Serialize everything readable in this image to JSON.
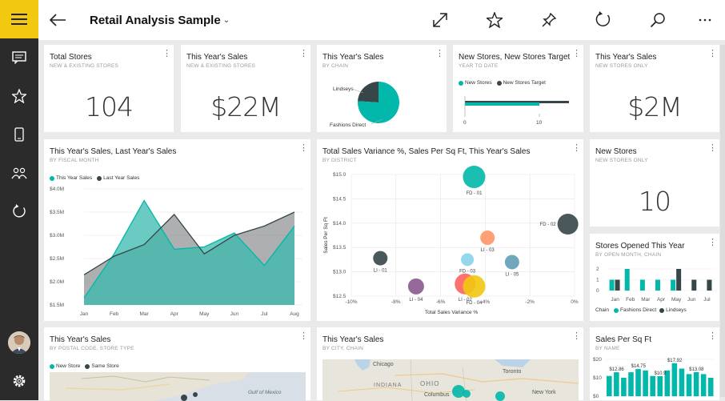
{
  "report_title": "Retail Analysis Sample",
  "colors": {
    "accent": "#f2c811",
    "teal": "#01b8aa",
    "dark": "#374649",
    "coral": "#fd625e",
    "yellow": "#f2c80f",
    "orange": "#fe9666",
    "blue": "#5f9eb5",
    "purple": "#8a5a8f"
  },
  "rail_icons": [
    "menu-icon",
    "chat-icon",
    "star-icon",
    "phone-icon",
    "people-icon",
    "refresh-icon",
    "avatar",
    "gear-icon"
  ],
  "tiles": {
    "total_stores": {
      "title": "Total Stores",
      "subtitle": "NEW & EXISTING STORES",
      "value": "104"
    },
    "sales_new_existing": {
      "title": "This Year's Sales",
      "subtitle": "NEW & EXISTING STORES",
      "value": "$22M"
    },
    "sales_by_chain": {
      "title": "This Year's Sales",
      "subtitle": "BY CHAIN",
      "labels": [
        "Lindseys",
        "Fashions Direct"
      ]
    },
    "new_stores_target": {
      "title": "New Stores, New Stores Target",
      "subtitle": "YEAR TO DATE",
      "legend": [
        "New Stores",
        "New Stores Target"
      ],
      "ticks": [
        "0",
        "10"
      ]
    },
    "sales_new_only": {
      "title": "This Year's Sales",
      "subtitle": "NEW STORES ONLY",
      "value": "$2M"
    },
    "sales_vs_last": {
      "title": "This Year's Sales, Last Year's Sales",
      "subtitle": "BY FISCAL MONTH",
      "legend": [
        "This Year Sales",
        "Last Year Sales"
      ]
    },
    "variance": {
      "title": "Total Sales Variance %, Sales Per Sq Ft, This Year's Sales",
      "subtitle": "BY DISTRICT",
      "xlabel": "Total Sales Variance %",
      "ylabel": "Sales Per Sq Ft"
    },
    "new_stores": {
      "title": "New Stores",
      "subtitle": "NEW STORES ONLY",
      "value": "10"
    },
    "stores_opened": {
      "title": "Stores Opened This Year",
      "subtitle": "BY OPEN MONTH, CHAIN",
      "legend_title": "Chain",
      "legend": [
        "Fashions Direct",
        "Lindseys"
      ]
    },
    "sales_postal": {
      "title": "This Year's Sales",
      "subtitle": "BY POSTAL CODE, STORE TYPE",
      "legend": [
        "New Store",
        "Same Store"
      ],
      "map_labels": [
        "Gulf of Mexico"
      ]
    },
    "sales_city": {
      "title": "This Year's Sales",
      "subtitle": "BY CITY, CHAIN",
      "map_labels": [
        "Chicago",
        "INDIANA",
        "OHIO",
        "Columbus",
        "Toronto",
        "New York"
      ]
    },
    "sales_sqft": {
      "title": "Sales Per Sq Ft",
      "subtitle": "BY NAME"
    }
  },
  "chart_data": [
    {
      "type": "area",
      "title": "This Year's Sales, Last Year's Sales",
      "categories": [
        "Jan",
        "Feb",
        "Mar",
        "Apr",
        "May",
        "Jun",
        "Jul",
        "Aug"
      ],
      "y_ticks": [
        "$4.0M",
        "$3.5M",
        "$3.0M",
        "$2.5M",
        "$2.0M",
        "$1.5M"
      ],
      "ylim": [
        1.5,
        4.0
      ],
      "series": [
        {
          "name": "This Year Sales",
          "values": [
            1.65,
            2.6,
            3.75,
            2.7,
            2.75,
            3.05,
            2.35,
            3.2
          ]
        },
        {
          "name": "Last Year Sales",
          "values": [
            2.15,
            2.55,
            2.8,
            3.45,
            2.6,
            3.0,
            3.2,
            3.5
          ]
        }
      ]
    },
    {
      "type": "pie",
      "title": "This Year's Sales",
      "labels": [
        "Lindseys",
        "Fashions Direct"
      ],
      "values": [
        24,
        76
      ]
    },
    {
      "type": "bar",
      "title": "New Stores, New Stores Target",
      "series": [
        {
          "name": "New Stores",
          "values": [
            10
          ]
        },
        {
          "name": "New Stores Target",
          "values": [
            14
          ]
        }
      ],
      "xlim": [
        0,
        14
      ],
      "ticks": [
        "0",
        "10"
      ]
    },
    {
      "type": "scatter",
      "title": "Total Sales Variance %, Sales Per Sq Ft, This Year's Sales",
      "x_ticks": [
        "-10%",
        "-8%",
        "-6%",
        "-4%",
        "-2%",
        "0%"
      ],
      "y_ticks": [
        "$15.0",
        "$14.5",
        "$14.0",
        "$13.5",
        "$13.0",
        "$12.5"
      ],
      "xlim": [
        -10,
        0
      ],
      "ylim": [
        12.5,
        15.0
      ],
      "points": [
        {
          "label": "FD - 01",
          "x": -4.5,
          "y": 14.95,
          "r": 14,
          "color": "#01b8aa"
        },
        {
          "label": "FD - 02",
          "x": -0.3,
          "y": 13.98,
          "r": 13,
          "color": "#374649"
        },
        {
          "label": "LI - 03",
          "x": -3.9,
          "y": 13.7,
          "r": 9,
          "color": "#fe9666"
        },
        {
          "label": "LI - 01",
          "x": -8.7,
          "y": 13.28,
          "r": 9,
          "color": "#374649"
        },
        {
          "label": "FD - 03",
          "x": -4.8,
          "y": 13.25,
          "r": 8,
          "color": "#8ad4eb"
        },
        {
          "label": "LI - 05",
          "x": -2.8,
          "y": 13.2,
          "r": 9,
          "color": "#5f9eb5"
        },
        {
          "label": "LI - 04",
          "x": -7.1,
          "y": 12.7,
          "r": 10,
          "color": "#8a5a8f"
        },
        {
          "label": "LI - 02",
          "x": -4.9,
          "y": 12.75,
          "r": 13,
          "color": "#fd625e"
        },
        {
          "label": "FD - 04",
          "x": -4.5,
          "y": 12.7,
          "r": 14,
          "color": "#f2c80f"
        }
      ]
    },
    {
      "type": "bar",
      "title": "Stores Opened This Year",
      "categories": [
        "Jan",
        "Feb",
        "Mar",
        "Apr",
        "May",
        "Jun",
        "Jul"
      ],
      "y_ticks": [
        "2",
        "1",
        "0"
      ],
      "ylim": [
        0,
        2
      ],
      "series": [
        {
          "name": "Fashions Direct",
          "values": [
            1,
            2,
            1,
            1,
            1,
            0,
            0
          ]
        },
        {
          "name": "Lindseys",
          "values": [
            1,
            0,
            0,
            0,
            2,
            1,
            1
          ]
        }
      ]
    },
    {
      "type": "bar",
      "title": "Sales Per Sq Ft",
      "y_ticks": [
        "$20",
        "$10",
        "$0"
      ],
      "ylim": [
        0,
        20
      ],
      "data_labels": [
        "$12.86",
        "$14.75",
        "$10.9",
        "$17.92",
        "$13.08"
      ],
      "values": [
        11,
        13,
        10,
        13,
        14.75,
        14,
        11,
        10.9,
        14,
        17.92,
        15,
        12,
        13.08,
        12,
        10
      ]
    }
  ]
}
